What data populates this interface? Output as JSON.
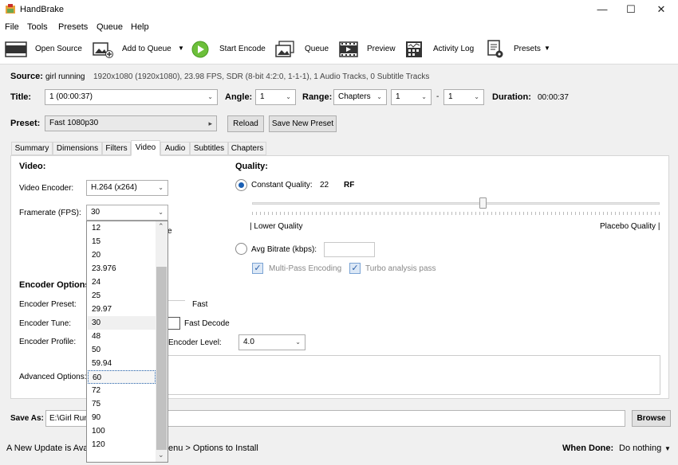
{
  "app": {
    "title": "HandBrake"
  },
  "menu": [
    "File",
    "Tools",
    "Presets",
    "Queue",
    "Help"
  ],
  "toolbar": {
    "open_source": "Open Source",
    "add_to_queue": "Add to Queue",
    "start_encode": "Start Encode",
    "queue": "Queue",
    "preview": "Preview",
    "activity_log": "Activity Log",
    "presets": "Presets"
  },
  "source": {
    "label": "Source:",
    "name": "girl running",
    "info": "1920x1080 (1920x1080), 23.98 FPS, SDR (8-bit 4:2:0, 1-1-1), 1 Audio Tracks, 0 Subtitle Tracks"
  },
  "title_row": {
    "title_label": "Title:",
    "title_value": "1  (00:00:37)",
    "angle_label": "Angle:",
    "angle_value": "1",
    "range_label": "Range:",
    "range_value": "Chapters",
    "range_from": "1",
    "range_sep": "-",
    "range_to": "1",
    "duration_label": "Duration:",
    "duration_value": "00:00:37"
  },
  "preset": {
    "label": "Preset:",
    "value": "Fast 1080p30",
    "reload": "Reload",
    "save_new": "Save New Preset"
  },
  "tabs": [
    "Summary",
    "Dimensions",
    "Filters",
    "Video",
    "Audio",
    "Subtitles",
    "Chapters"
  ],
  "video": {
    "section": "Video:",
    "encoder_label": "Video Encoder:",
    "encoder_value": "H.264 (x264)",
    "framerate_label": "Framerate (FPS):",
    "framerate_value": "30",
    "hidden_e": "e"
  },
  "quality": {
    "section": "Quality:",
    "cq_label": "Constant Quality:",
    "cq_value": "22",
    "rf": "RF",
    "slider_value": 22,
    "lower": "| Lower Quality",
    "higher": "Placebo Quality |",
    "avg_label": "Avg Bitrate (kbps):",
    "multipass": "Multi-Pass Encoding",
    "turbo": "Turbo analysis pass"
  },
  "encoder_options": {
    "section": "Encoder Options",
    "preset_label": "Encoder Preset:",
    "preset_fast": "Fast",
    "tune_label": "Encoder Tune:",
    "fast_decode": "Fast Decode",
    "profile_label": "Encoder Profile:",
    "level_label": "Encoder Level:",
    "level_value": "4.0",
    "advanced_label": "Advanced Options:"
  },
  "fps_options": [
    "12",
    "15",
    "20",
    "23.976",
    "24",
    "25",
    "29.97",
    "30",
    "48",
    "50",
    "59.94",
    "60",
    "72",
    "75",
    "90",
    "100",
    "120"
  ],
  "save_as": {
    "label": "Save As:",
    "value": "E:\\Girl Run",
    "browse": "Browse"
  },
  "status": {
    "update": "A New Update is Avai",
    "update_tail": "enu > Options to Install",
    "when_done_label": "When Done:",
    "when_done_value": "Do nothing"
  }
}
